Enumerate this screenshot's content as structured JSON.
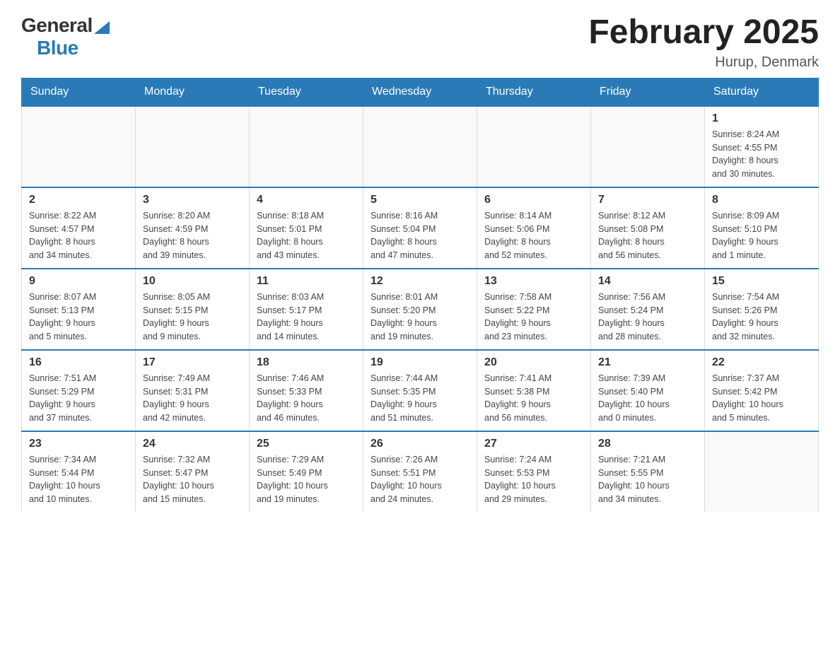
{
  "header": {
    "logo_general": "General",
    "logo_blue": "Blue",
    "title": "February 2025",
    "location": "Hurup, Denmark"
  },
  "weekdays": [
    "Sunday",
    "Monday",
    "Tuesday",
    "Wednesday",
    "Thursday",
    "Friday",
    "Saturday"
  ],
  "weeks": [
    [
      {
        "day": "",
        "info": ""
      },
      {
        "day": "",
        "info": ""
      },
      {
        "day": "",
        "info": ""
      },
      {
        "day": "",
        "info": ""
      },
      {
        "day": "",
        "info": ""
      },
      {
        "day": "",
        "info": ""
      },
      {
        "day": "1",
        "info": "Sunrise: 8:24 AM\nSunset: 4:55 PM\nDaylight: 8 hours\nand 30 minutes."
      }
    ],
    [
      {
        "day": "2",
        "info": "Sunrise: 8:22 AM\nSunset: 4:57 PM\nDaylight: 8 hours\nand 34 minutes."
      },
      {
        "day": "3",
        "info": "Sunrise: 8:20 AM\nSunset: 4:59 PM\nDaylight: 8 hours\nand 39 minutes."
      },
      {
        "day": "4",
        "info": "Sunrise: 8:18 AM\nSunset: 5:01 PM\nDaylight: 8 hours\nand 43 minutes."
      },
      {
        "day": "5",
        "info": "Sunrise: 8:16 AM\nSunset: 5:04 PM\nDaylight: 8 hours\nand 47 minutes."
      },
      {
        "day": "6",
        "info": "Sunrise: 8:14 AM\nSunset: 5:06 PM\nDaylight: 8 hours\nand 52 minutes."
      },
      {
        "day": "7",
        "info": "Sunrise: 8:12 AM\nSunset: 5:08 PM\nDaylight: 8 hours\nand 56 minutes."
      },
      {
        "day": "8",
        "info": "Sunrise: 8:09 AM\nSunset: 5:10 PM\nDaylight: 9 hours\nand 1 minute."
      }
    ],
    [
      {
        "day": "9",
        "info": "Sunrise: 8:07 AM\nSunset: 5:13 PM\nDaylight: 9 hours\nand 5 minutes."
      },
      {
        "day": "10",
        "info": "Sunrise: 8:05 AM\nSunset: 5:15 PM\nDaylight: 9 hours\nand 9 minutes."
      },
      {
        "day": "11",
        "info": "Sunrise: 8:03 AM\nSunset: 5:17 PM\nDaylight: 9 hours\nand 14 minutes."
      },
      {
        "day": "12",
        "info": "Sunrise: 8:01 AM\nSunset: 5:20 PM\nDaylight: 9 hours\nand 19 minutes."
      },
      {
        "day": "13",
        "info": "Sunrise: 7:58 AM\nSunset: 5:22 PM\nDaylight: 9 hours\nand 23 minutes."
      },
      {
        "day": "14",
        "info": "Sunrise: 7:56 AM\nSunset: 5:24 PM\nDaylight: 9 hours\nand 28 minutes."
      },
      {
        "day": "15",
        "info": "Sunrise: 7:54 AM\nSunset: 5:26 PM\nDaylight: 9 hours\nand 32 minutes."
      }
    ],
    [
      {
        "day": "16",
        "info": "Sunrise: 7:51 AM\nSunset: 5:29 PM\nDaylight: 9 hours\nand 37 minutes."
      },
      {
        "day": "17",
        "info": "Sunrise: 7:49 AM\nSunset: 5:31 PM\nDaylight: 9 hours\nand 42 minutes."
      },
      {
        "day": "18",
        "info": "Sunrise: 7:46 AM\nSunset: 5:33 PM\nDaylight: 9 hours\nand 46 minutes."
      },
      {
        "day": "19",
        "info": "Sunrise: 7:44 AM\nSunset: 5:35 PM\nDaylight: 9 hours\nand 51 minutes."
      },
      {
        "day": "20",
        "info": "Sunrise: 7:41 AM\nSunset: 5:38 PM\nDaylight: 9 hours\nand 56 minutes."
      },
      {
        "day": "21",
        "info": "Sunrise: 7:39 AM\nSunset: 5:40 PM\nDaylight: 10 hours\nand 0 minutes."
      },
      {
        "day": "22",
        "info": "Sunrise: 7:37 AM\nSunset: 5:42 PM\nDaylight: 10 hours\nand 5 minutes."
      }
    ],
    [
      {
        "day": "23",
        "info": "Sunrise: 7:34 AM\nSunset: 5:44 PM\nDaylight: 10 hours\nand 10 minutes."
      },
      {
        "day": "24",
        "info": "Sunrise: 7:32 AM\nSunset: 5:47 PM\nDaylight: 10 hours\nand 15 minutes."
      },
      {
        "day": "25",
        "info": "Sunrise: 7:29 AM\nSunset: 5:49 PM\nDaylight: 10 hours\nand 19 minutes."
      },
      {
        "day": "26",
        "info": "Sunrise: 7:26 AM\nSunset: 5:51 PM\nDaylight: 10 hours\nand 24 minutes."
      },
      {
        "day": "27",
        "info": "Sunrise: 7:24 AM\nSunset: 5:53 PM\nDaylight: 10 hours\nand 29 minutes."
      },
      {
        "day": "28",
        "info": "Sunrise: 7:21 AM\nSunset: 5:55 PM\nDaylight: 10 hours\nand 34 minutes."
      },
      {
        "day": "",
        "info": ""
      }
    ]
  ]
}
